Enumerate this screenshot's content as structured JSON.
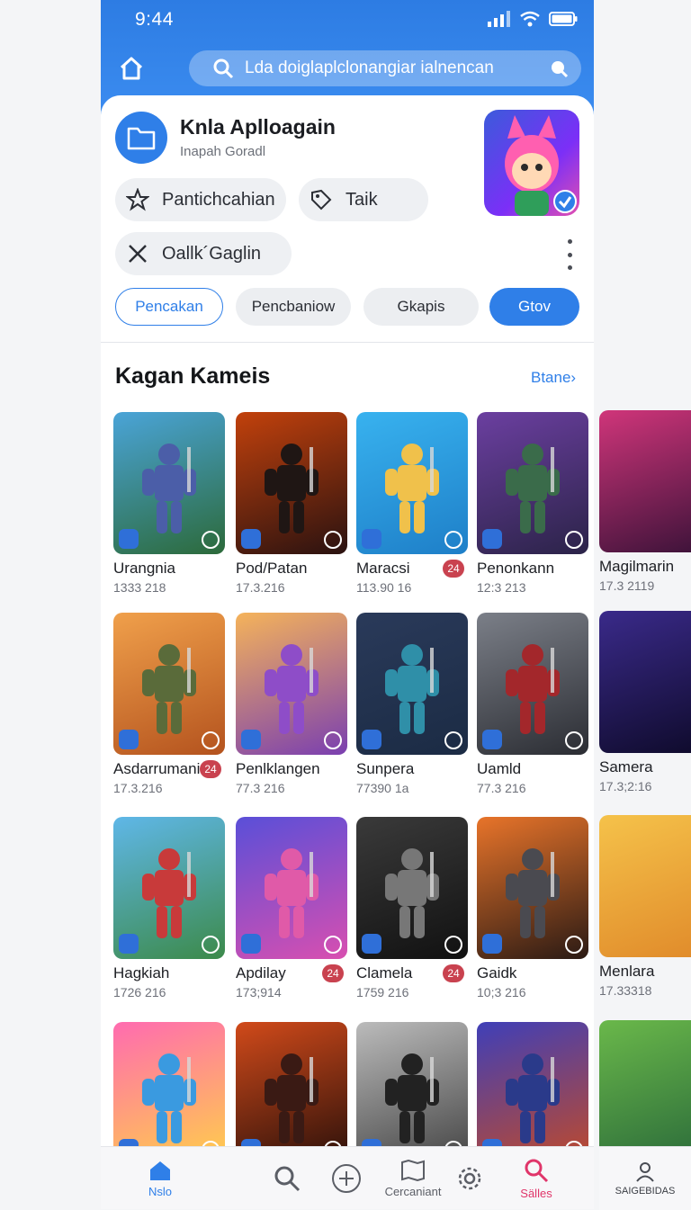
{
  "status": {
    "time": "9:44"
  },
  "search": {
    "placeholder": "Lda doiglaplclonangiar ialnencan"
  },
  "app": {
    "title": "Knla Aplloagain",
    "subtitle": "Inapah Goradl",
    "pills": [
      "Pantichcahian",
      "Taik",
      "Oallk´Gaglin"
    ],
    "tabs": [
      "Pencakan",
      "Pencbaniow",
      "Gkapis",
      "Gtov"
    ]
  },
  "section": {
    "title": "Kagan Kameis",
    "link": "Btane›"
  },
  "games": [
    {
      "name": "Urangnia",
      "sub": "1333 218",
      "rating": "",
      "colors": [
        "#4aa4d8",
        "#2c6a3a"
      ],
      "fig": "#4b5ea8"
    },
    {
      "name": "Pod/Patan",
      "sub": "17.3.216",
      "rating": "",
      "colors": [
        "#c2410c",
        "#2a1210"
      ],
      "fig": "#1f1614"
    },
    {
      "name": "Maracsi",
      "sub": "113.90 16",
      "rating": "24",
      "colors": [
        "#38b2ef",
        "#1e7fc8"
      ],
      "fig": "#f0c14b"
    },
    {
      "name": "Penonkann",
      "sub": "12:3 213",
      "rating": "",
      "colors": [
        "#6b3fa0",
        "#2b2348"
      ],
      "fig": "#3a6b4a"
    },
    {
      "name": "Asdarrumani",
      "sub": "17.3.216",
      "rating": "24",
      "colors": [
        "#f0a04b",
        "#b4531e"
      ],
      "fig": "#5a6b3a"
    },
    {
      "name": "Penlklangen",
      "sub": "77.3 216",
      "rating": "",
      "colors": [
        "#f5b35a",
        "#7a3fb0"
      ],
      "fig": "#8e4dc8"
    },
    {
      "name": "Sunpera",
      "sub": "77390 1a",
      "rating": "",
      "colors": [
        "#2a3a5a",
        "#1b2b44"
      ],
      "fig": "#2f8fa8"
    },
    {
      "name": "Uamld",
      "sub": "77.3 216",
      "rating": "",
      "colors": [
        "#7b7f88",
        "#2b2d33"
      ],
      "fig": "#a3272b"
    },
    {
      "name": "Hagkiah",
      "sub": "1726 216",
      "rating": "",
      "colors": [
        "#5fb7e8",
        "#3c8a4a"
      ],
      "fig": "#c83a3a"
    },
    {
      "name": "Apdilay",
      "sub": "173;914",
      "rating": "24",
      "colors": [
        "#5a4fd8",
        "#d84fb0"
      ],
      "fig": "#e05aa8"
    },
    {
      "name": "Clamela",
      "sub": "1759 216",
      "rating": "24",
      "colors": [
        "#3a3a3a",
        "#111111"
      ],
      "fig": "#777777"
    },
    {
      "name": "Gaidk",
      "sub": "10;3 216",
      "rating": "",
      "colors": [
        "#e8742a",
        "#2a1a14"
      ],
      "fig": "#4a4a50"
    },
    {
      "name": "",
      "sub": "",
      "rating": "",
      "colors": [
        "#ff6bb0",
        "#ffcf4a"
      ],
      "fig": "#3a9ae0"
    },
    {
      "name": "",
      "sub": "",
      "rating": "",
      "colors": [
        "#d14a1a",
        "#2a100a"
      ],
      "fig": "#3a1a14"
    },
    {
      "name": "",
      "sub": "",
      "rating": "",
      "colors": [
        "#bbbbbb",
        "#444444"
      ],
      "fig": "#222222"
    },
    {
      "name": "",
      "sub": "",
      "rating": "",
      "colors": [
        "#3f3fb8",
        "#c04a2a"
      ],
      "fig": "#2a3a8a"
    }
  ],
  "right_games": [
    {
      "name": "Magilmarin",
      "sub": "17.3 2119",
      "colors": [
        "#d0357a",
        "#3a1238"
      ]
    },
    {
      "name": "Samera",
      "sub": "17.3;2:16",
      "colors": [
        "#3a2a8a",
        "#0e0a2a"
      ]
    },
    {
      "name": "Menlara",
      "sub": "17.33318",
      "colors": [
        "#f5c24a",
        "#e08a2a"
      ]
    },
    {
      "name": "",
      "sub": "",
      "colors": [
        "#6ab84a",
        "#2a6a3a"
      ]
    }
  ],
  "nav": {
    "items": [
      "Nslo",
      "",
      "",
      "Cercaniant",
      "",
      "Sälles"
    ],
    "right": "SAIGEBIDAS",
    "active_color": "#2f7fe8",
    "accent_color": "#e0356a"
  }
}
